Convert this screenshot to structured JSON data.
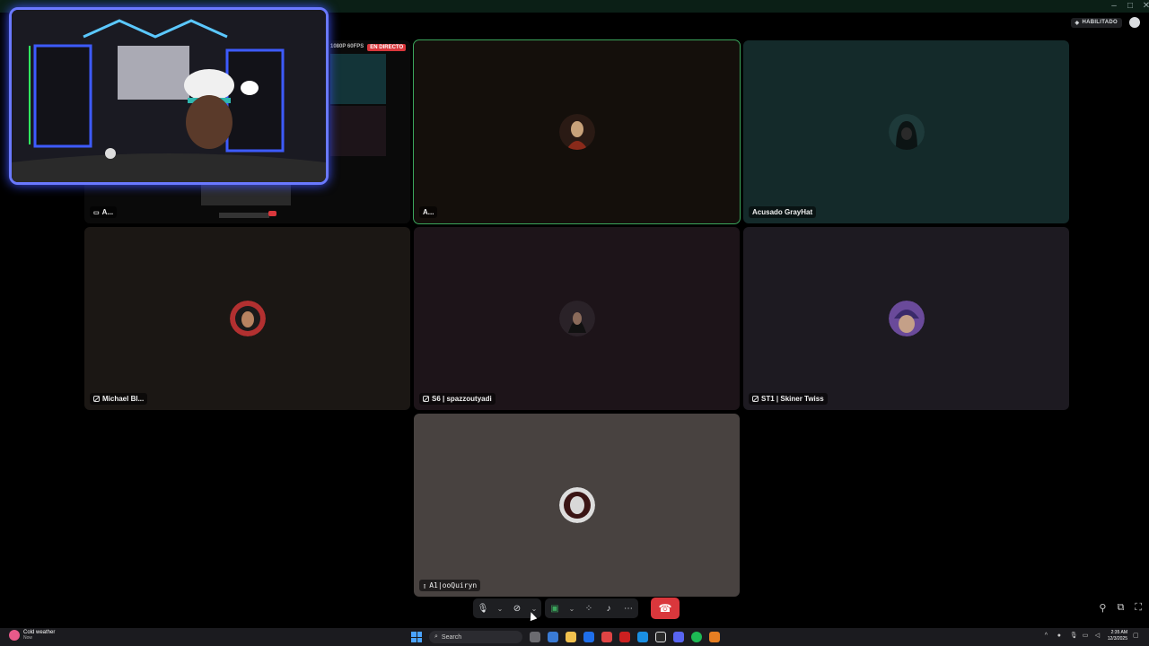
{
  "topbar": {
    "status_badge": "HABILITADO"
  },
  "stream_overlay": {
    "quality": "1080P 60FPS",
    "live_label": "EN DIRECTO"
  },
  "tiles": [
    {
      "name": "A...",
      "bg": "#0a0a0a",
      "avatar_color": "#7a5a4a"
    },
    {
      "name": "A...",
      "bg": "#140f0b",
      "avatar_color": "#7a4a34",
      "speaking": true
    },
    {
      "name": "Acusado GrayHat",
      "bg": "#142a2a",
      "avatar_color": "#2c5050"
    },
    {
      "name": "Michael Bl...",
      "bg": "#1b1714",
      "avatar_color": "#6b2d2d"
    },
    {
      "name": "S6 | spazzoutyadi",
      "bg": "#1d1419",
      "avatar_color": "#3b2f35"
    },
    {
      "name": "ST1 | Skiner Twiss",
      "bg": "#1d1a21",
      "avatar_color": "#5a3e86"
    },
    {
      "name": "A1|ooQuiryn",
      "bg": "#484240",
      "avatar_color": "#9a8f8a"
    }
  ],
  "controls": {
    "mic": "microphone-icon",
    "camera": "camera-off-icon",
    "screenshare": "screen-share-icon",
    "activities": "activities-icon",
    "soundboard": "soundboard-icon",
    "more": "more-icon",
    "end_call": "hang-up-icon"
  },
  "taskbar": {
    "weather_title": "Cold weather",
    "weather_sub": "Now",
    "search_placeholder": "Search",
    "time": "2:35 AM",
    "date": "12/3/2025"
  },
  "colors": {
    "speaking_outline": "#3ba55c",
    "end_call": "#da373c",
    "live_badge": "#da373c",
    "webcam_border": "#6a79ff"
  }
}
